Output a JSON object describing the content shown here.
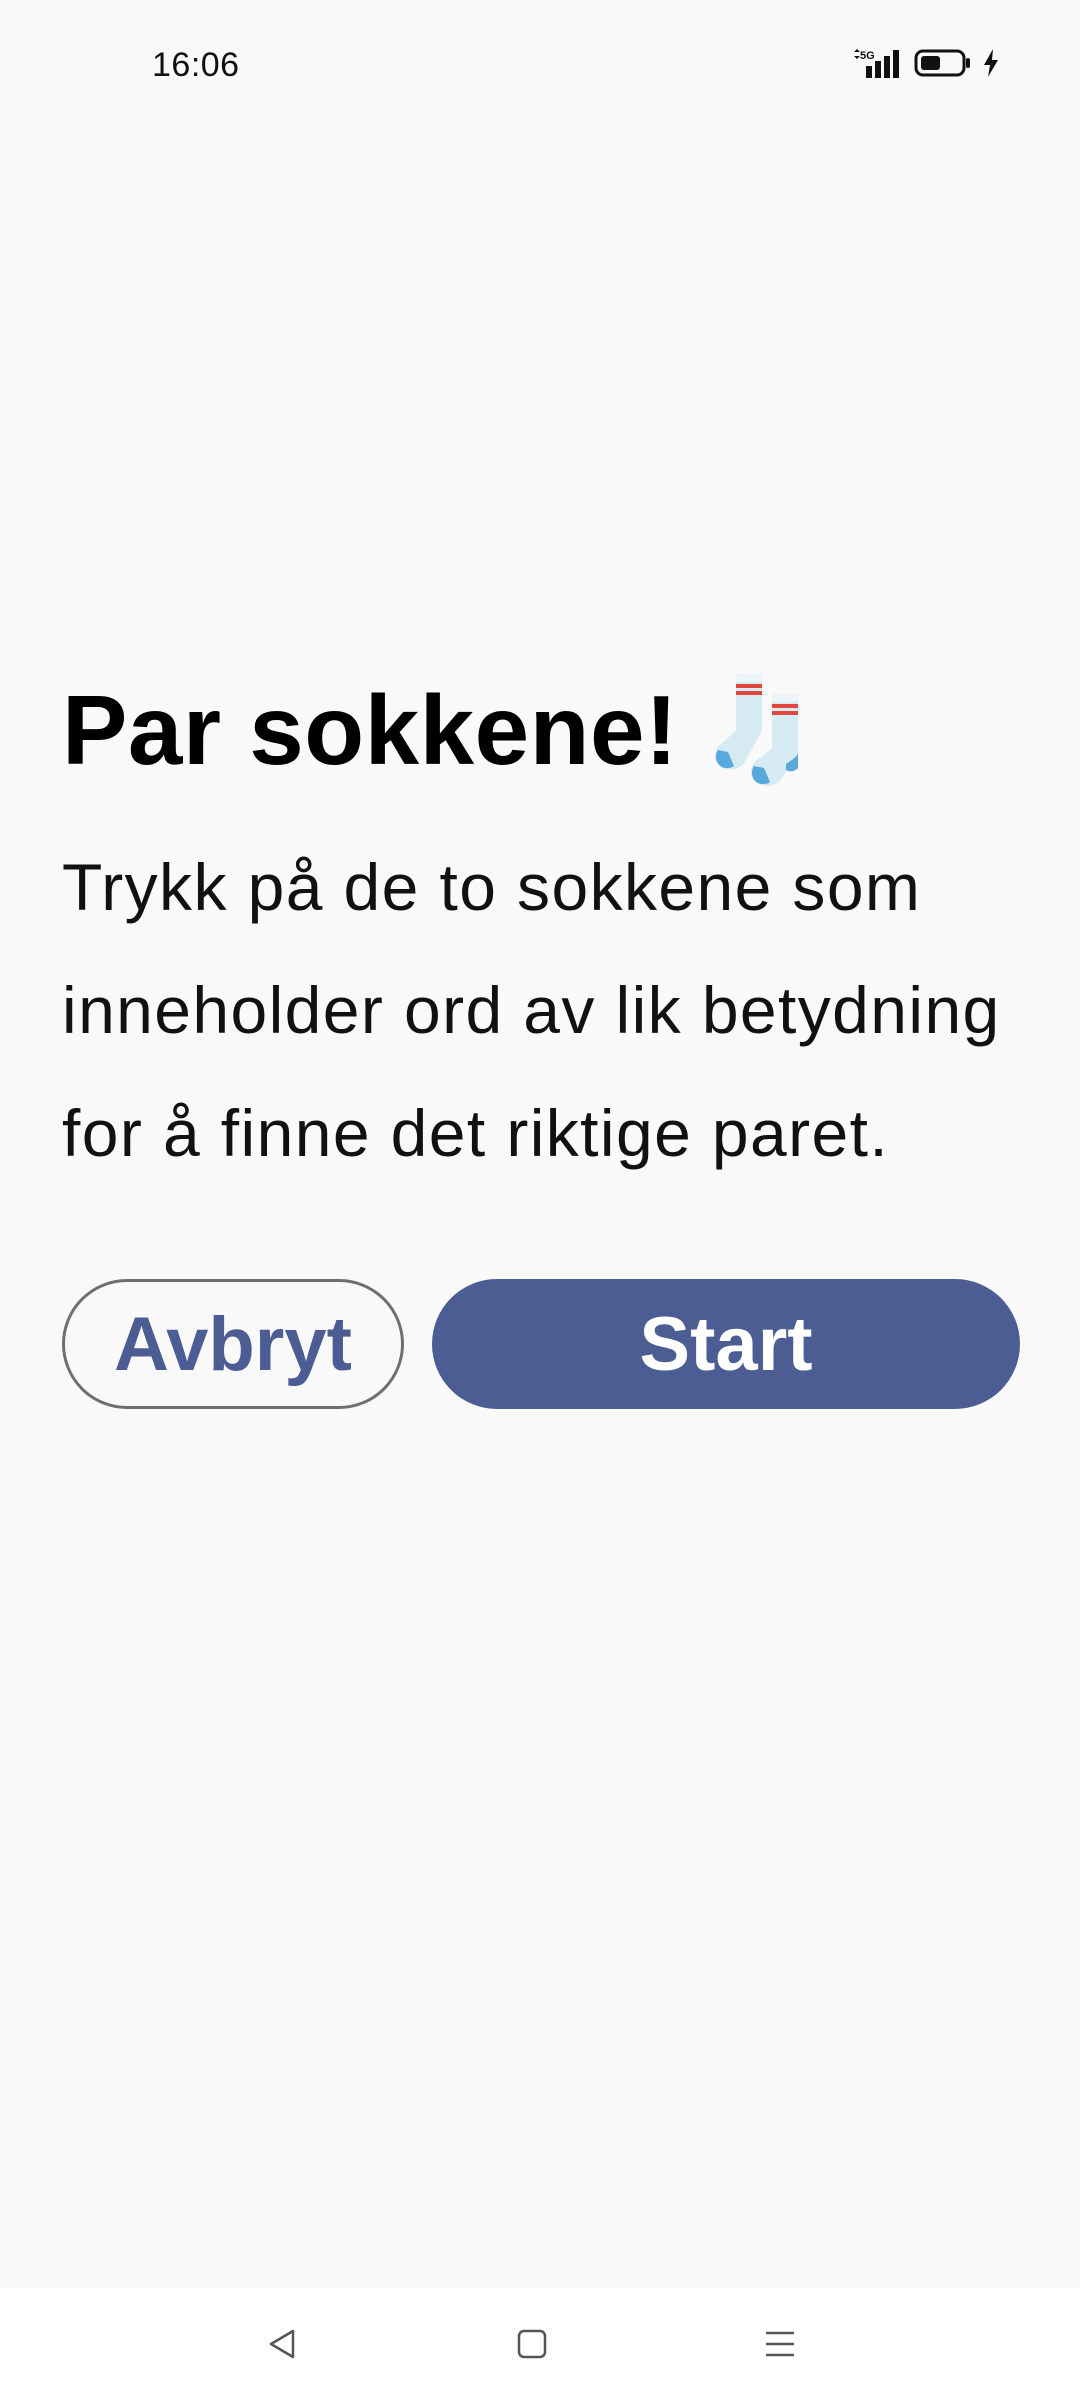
{
  "status_bar": {
    "time": "16:06",
    "network_label": "5G",
    "icons": [
      "signal-5g-icon",
      "battery-icon",
      "charging-bolt-icon"
    ]
  },
  "main": {
    "title": "Par sokkene!",
    "title_emoji_icon": "socks-icon",
    "description": "Trykk på de to sokkene som inneholder ord av lik betydning for å finne det riktige paret.",
    "cancel_label": "Avbryt",
    "start_label": "Start"
  },
  "nav_bar": {
    "icons": [
      "back-icon",
      "home-icon",
      "recents-menu-icon"
    ]
  },
  "colors": {
    "background": "#f9f9fa",
    "accent": "#4b5d92",
    "cancel_border": "#6f6f6f",
    "sock_blue": "#5aa9dc",
    "sock_body": "#d6eaf3",
    "sock_stripe": "#e0463d"
  }
}
